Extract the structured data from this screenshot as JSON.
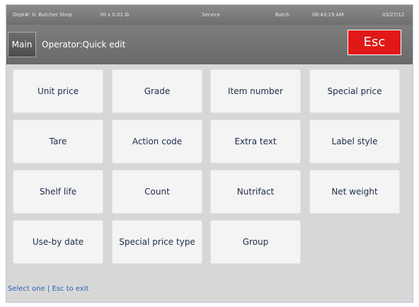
{
  "status_bar": {
    "dept": "Dept#: 0: Butcher Shop",
    "weight": "30 x 0.01 lb",
    "mode": "Service",
    "batch": "Batch",
    "time": "08:43:19 AM",
    "date": "03/27/12"
  },
  "header": {
    "main_label": "Main",
    "operator_text": "Operator:Quick edit",
    "esc_label": "Esc"
  },
  "menu": {
    "unit_price": "Unit price",
    "grade": "Grade",
    "item_number": "Item number",
    "special_price": "Special price",
    "tare": "Tare",
    "action_code": "Action code",
    "extra_text": "Extra text",
    "label_style": "Label style",
    "shelf_life": "Shelf life",
    "count": "Count",
    "nutrifact": "Nutrifact",
    "net_weight": "Net weight",
    "use_by_date": "Use-by date",
    "special_price_type": "Special price type",
    "group": "Group"
  },
  "footer": {
    "hint": "Select one | Esc to exit"
  }
}
